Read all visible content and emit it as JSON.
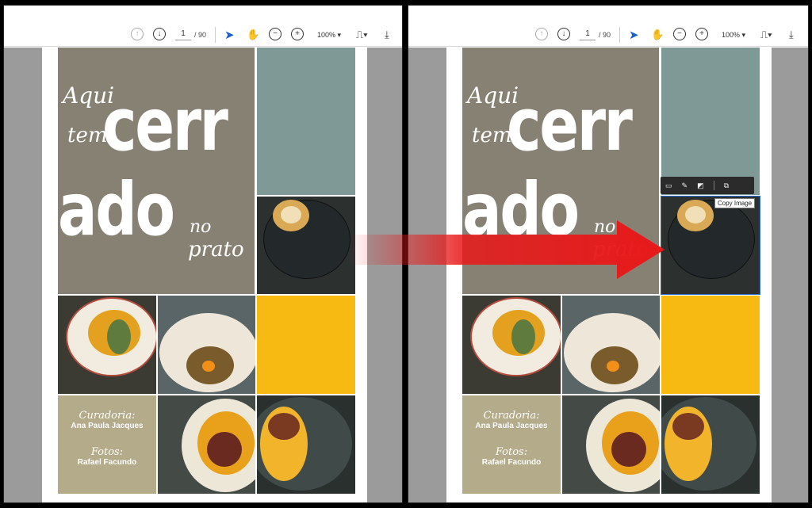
{
  "toolbar": {
    "page_current": "1",
    "page_total": "/ 90",
    "zoom": "100%"
  },
  "icons": [
    "arrow-up-circle-icon",
    "arrow-down-circle-icon",
    "pointer-icon",
    "hand-icon",
    "zoom-out-icon",
    "zoom-in-icon",
    "page-fit-icon",
    "download-icon"
  ],
  "cover": {
    "aqui": "Aqui",
    "tem": "tem",
    "word1": "cerr",
    "word2": "ado",
    "no": "no",
    "prato": "prato",
    "curadoria_label": "Curadoria:",
    "curadoria_name": "Ana Paula Jacques",
    "fotos_label": "Fotos:",
    "fotos_name": "Rafael Facundo"
  },
  "popup": {
    "tooltip": "Copy Image",
    "buttons": [
      "comment-icon",
      "pencil-icon",
      "crop-icon",
      "copy-image-icon"
    ]
  },
  "colors": {
    "title_block": "#878174",
    "teal_block": "#7f9a96",
    "yellow_block": "#f7ba12",
    "credit_block": "#b4ab8a",
    "arrow": "#e8191a",
    "accent": "#2b6de0"
  }
}
